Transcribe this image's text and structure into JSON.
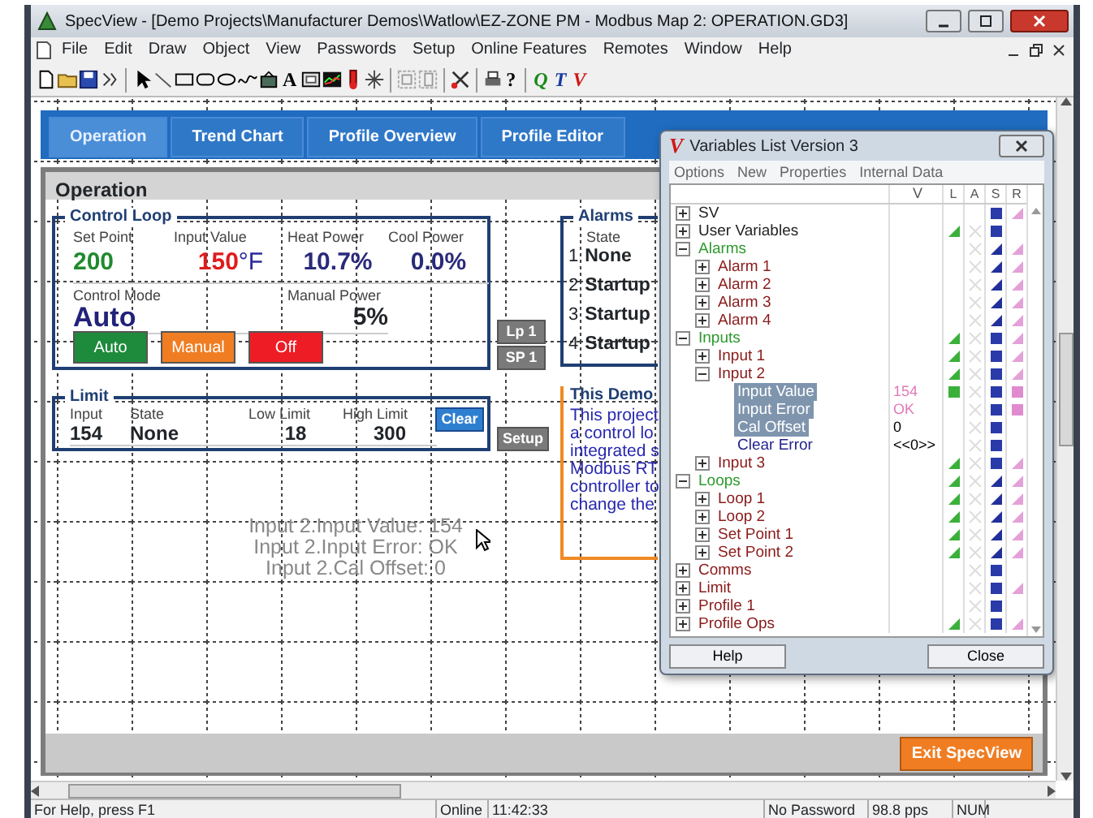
{
  "window": {
    "title": "SpecView - [Demo Projects\\Manufacturer Demos\\Watlow\\EZ-ZONE PM - Modbus Map 2: OPERATION.GD3]"
  },
  "menu": [
    "File",
    "Edit",
    "Draw",
    "Object",
    "View",
    "Passwords",
    "Setup",
    "Online Features",
    "Remotes",
    "Window",
    "Help"
  ],
  "toolbar_labels": [
    {
      "label": "A",
      "color": "#000000"
    },
    {
      "label": "?",
      "color": "#000000"
    },
    {
      "label": "Q",
      "color": "#1a8a1a"
    },
    {
      "label": "T",
      "color": "#1a3aa0"
    },
    {
      "label": "V",
      "color": "#d01818"
    }
  ],
  "tabs": [
    {
      "label": "Operation",
      "selected": true
    },
    {
      "label": "Trend Chart",
      "selected": false
    },
    {
      "label": "Profile Overview",
      "selected": false
    },
    {
      "label": "Profile Editor",
      "selected": false
    }
  ],
  "panel_title": "Operation",
  "control_loop": {
    "title": "Control Loop",
    "readings": [
      {
        "label": "Set Point",
        "value": "200",
        "color": "#1f8a2e"
      },
      {
        "label": "Input Value",
        "value": "150",
        "unit": "°F",
        "color": "#e01b1b"
      },
      {
        "label": "Heat Power",
        "value": "10.7%",
        "color": "#2a2a7a"
      },
      {
        "label": "Cool Power",
        "value": "0.0%",
        "color": "#2a2a7a"
      }
    ],
    "mode": {
      "label": "Control Mode",
      "value": "Auto"
    },
    "manual_power": {
      "label": "Manual Power",
      "value": "5%"
    },
    "buttons": [
      {
        "label": "Auto",
        "color": "#1e8a3c"
      },
      {
        "label": "Manual",
        "color": "#f07d22"
      },
      {
        "label": "Off",
        "color": "#ee1c24"
      }
    ]
  },
  "loop_buttons": [
    "Lp 1",
    "SP 1"
  ],
  "alarms": {
    "title": "Alarms",
    "column": "State",
    "rows": [
      {
        "number": "1",
        "state": "None"
      },
      {
        "number": "2",
        "state": "Startup"
      },
      {
        "number": "3",
        "state": "Startup"
      },
      {
        "number": "4",
        "state": "Startup"
      }
    ]
  },
  "limit": {
    "title": "Limit",
    "fields": [
      {
        "label": "Input",
        "value": "154"
      },
      {
        "label": "State",
        "value": "None"
      },
      {
        "label": "Low Limit",
        "value": "18"
      },
      {
        "label": "High Limit",
        "value": "300"
      }
    ],
    "button": "Clear"
  },
  "setup_button": "Setup",
  "demo": {
    "title": "This Demo",
    "lines": [
      "This project",
      "a control lo",
      "integrated s",
      "Modbus RT",
      "controller to",
      "change the"
    ]
  },
  "readout": [
    "Input 2.Input Value: 154",
    "Input 2.Input Error: OK",
    "Input 2.Cal Offset: 0"
  ],
  "exit_button": "Exit SpecView",
  "dialog": {
    "logo": "V",
    "title": "Variables List Version 3",
    "menu": [
      "Options",
      "New",
      "Properties",
      "Internal Data"
    ],
    "columns": [
      "V",
      "L",
      "A",
      "S",
      "R"
    ],
    "tree": [
      {
        "label": "SV",
        "expanded": false,
        "color": "#222222",
        "s": {
          "kind": "square"
        },
        "r": {
          "kind": "triangle"
        }
      },
      {
        "label": "User Variables",
        "expanded": false,
        "color": "#222222",
        "l": {
          "kind": "triangle"
        },
        "a": {
          "kind": "cross"
        },
        "s": {
          "kind": "square"
        }
      },
      {
        "label": "Alarms",
        "expanded": true,
        "color": "#2e9a2e",
        "a": {
          "kind": "cross"
        },
        "s": {
          "kind": "triangle"
        },
        "r": {
          "kind": "triangle"
        },
        "children": [
          {
            "label": "Alarm 1",
            "expanded": false,
            "color": "#8b1a1a",
            "a": {
              "kind": "cross"
            },
            "s": {
              "kind": "triangle"
            },
            "r": {
              "kind": "triangle"
            }
          },
          {
            "label": "Alarm 2",
            "expanded": false,
            "color": "#8b1a1a",
            "a": {
              "kind": "cross"
            },
            "s": {
              "kind": "triangle"
            },
            "r": {
              "kind": "triangle"
            }
          },
          {
            "label": "Alarm 3",
            "expanded": false,
            "color": "#8b1a1a",
            "a": {
              "kind": "cross"
            },
            "s": {
              "kind": "triangle"
            },
            "r": {
              "kind": "triangle"
            }
          },
          {
            "label": "Alarm 4",
            "expanded": false,
            "color": "#8b1a1a",
            "a": {
              "kind": "cross"
            },
            "s": {
              "kind": "triangle"
            },
            "r": {
              "kind": "triangle"
            }
          }
        ]
      },
      {
        "label": "Inputs",
        "expanded": true,
        "color": "#2e9a2e",
        "l": {
          "kind": "triangle"
        },
        "a": {
          "kind": "cross"
        },
        "s": {
          "kind": "square"
        },
        "r": {
          "kind": "triangle"
        },
        "children": [
          {
            "label": "Input 1",
            "expanded": false,
            "color": "#8b1a1a",
            "l": {
              "kind": "triangle"
            },
            "a": {
              "kind": "cross"
            },
            "s": {
              "kind": "square"
            },
            "r": {
              "kind": "triangle"
            }
          },
          {
            "label": "Input 2",
            "expanded": true,
            "color": "#8b1a1a",
            "l": {
              "kind": "triangle"
            },
            "a": {
              "kind": "cross"
            },
            "s": {
              "kind": "square"
            },
            "r": {
              "kind": "triangle"
            },
            "children": [
              {
                "label": "Input Value",
                "selected": true,
                "value": "154",
                "value_tinted": true,
                "l": {
                  "kind": "square"
                },
                "a": {
                  "kind": "cross"
                },
                "s": {
                  "kind": "square"
                },
                "r": {
                  "kind": "square"
                }
              },
              {
                "label": "Input Error",
                "selected": true,
                "value": "OK",
                "value_tinted": true,
                "a": {
                  "kind": "cross"
                },
                "s": {
                  "kind": "square"
                },
                "r": {
                  "kind": "square"
                }
              },
              {
                "label": "Cal Offset",
                "selected": true,
                "value": "0",
                "a": {
                  "kind": "cross"
                },
                "s": {
                  "kind": "square"
                }
              },
              {
                "label": "Clear Error",
                "selected": false,
                "color": "#23238e",
                "value": "<<0>>",
                "a": {
                  "kind": "cross"
                },
                "s": {
                  "kind": "square"
                }
              }
            ]
          },
          {
            "label": "Input 3",
            "expanded": false,
            "color": "#8b1a1a",
            "l": {
              "kind": "triangle"
            },
            "a": {
              "kind": "cross"
            },
            "s": {
              "kind": "square"
            },
            "r": {
              "kind": "triangle"
            }
          }
        ]
      },
      {
        "label": "Loops",
        "expanded": true,
        "color": "#2e9a2e",
        "l": {
          "kind": "triangle"
        },
        "a": {
          "kind": "cross"
        },
        "s": {
          "kind": "triangle"
        },
        "r": {
          "kind": "triangle"
        },
        "children": [
          {
            "label": "Loop 1",
            "expanded": false,
            "color": "#8b1a1a",
            "l": {
              "kind": "triangle"
            },
            "a": {
              "kind": "cross"
            },
            "s": {
              "kind": "triangle"
            },
            "r": {
              "kind": "triangle"
            }
          },
          {
            "label": "Loop 2",
            "expanded": false,
            "color": "#8b1a1a",
            "l": {
              "kind": "triangle"
            },
            "a": {
              "kind": "cross"
            },
            "s": {
              "kind": "triangle"
            },
            "r": {
              "kind": "triangle"
            }
          },
          {
            "label": "Set Point 1",
            "expanded": false,
            "color": "#8b1a1a",
            "l": {
              "kind": "triangle"
            },
            "a": {
              "kind": "cross"
            },
            "s": {
              "kind": "triangle"
            },
            "r": {
              "kind": "triangle"
            }
          },
          {
            "label": "Set Point 2",
            "expanded": false,
            "color": "#8b1a1a",
            "l": {
              "kind": "triangle"
            },
            "a": {
              "kind": "cross"
            },
            "s": {
              "kind": "triangle"
            },
            "r": {
              "kind": "triangle"
            }
          }
        ]
      },
      {
        "label": "Comms",
        "expanded": false,
        "color": "#8b1a1a",
        "a": {
          "kind": "cross"
        },
        "s": {
          "kind": "square"
        }
      },
      {
        "label": "Limit",
        "expanded": false,
        "color": "#8b1a1a",
        "a": {
          "kind": "cross"
        },
        "s": {
          "kind": "square"
        },
        "r": {
          "kind": "triangle"
        }
      },
      {
        "label": "Profile 1",
        "expanded": false,
        "color": "#8b1a1a",
        "a": {
          "kind": "cross"
        },
        "s": {
          "kind": "square"
        }
      },
      {
        "label": "Profile Ops",
        "expanded": false,
        "color": "#8b1a1a",
        "l": {
          "kind": "triangle"
        },
        "a": {
          "kind": "cross"
        },
        "s": {
          "kind": "square"
        },
        "r": {
          "kind": "triangle"
        }
      }
    ],
    "buttons": [
      "Help",
      "Close"
    ]
  },
  "status_bar": [
    "For Help, press F1",
    "Online",
    "11:42:33",
    "No Password",
    "98.8 pps",
    "NUM"
  ]
}
